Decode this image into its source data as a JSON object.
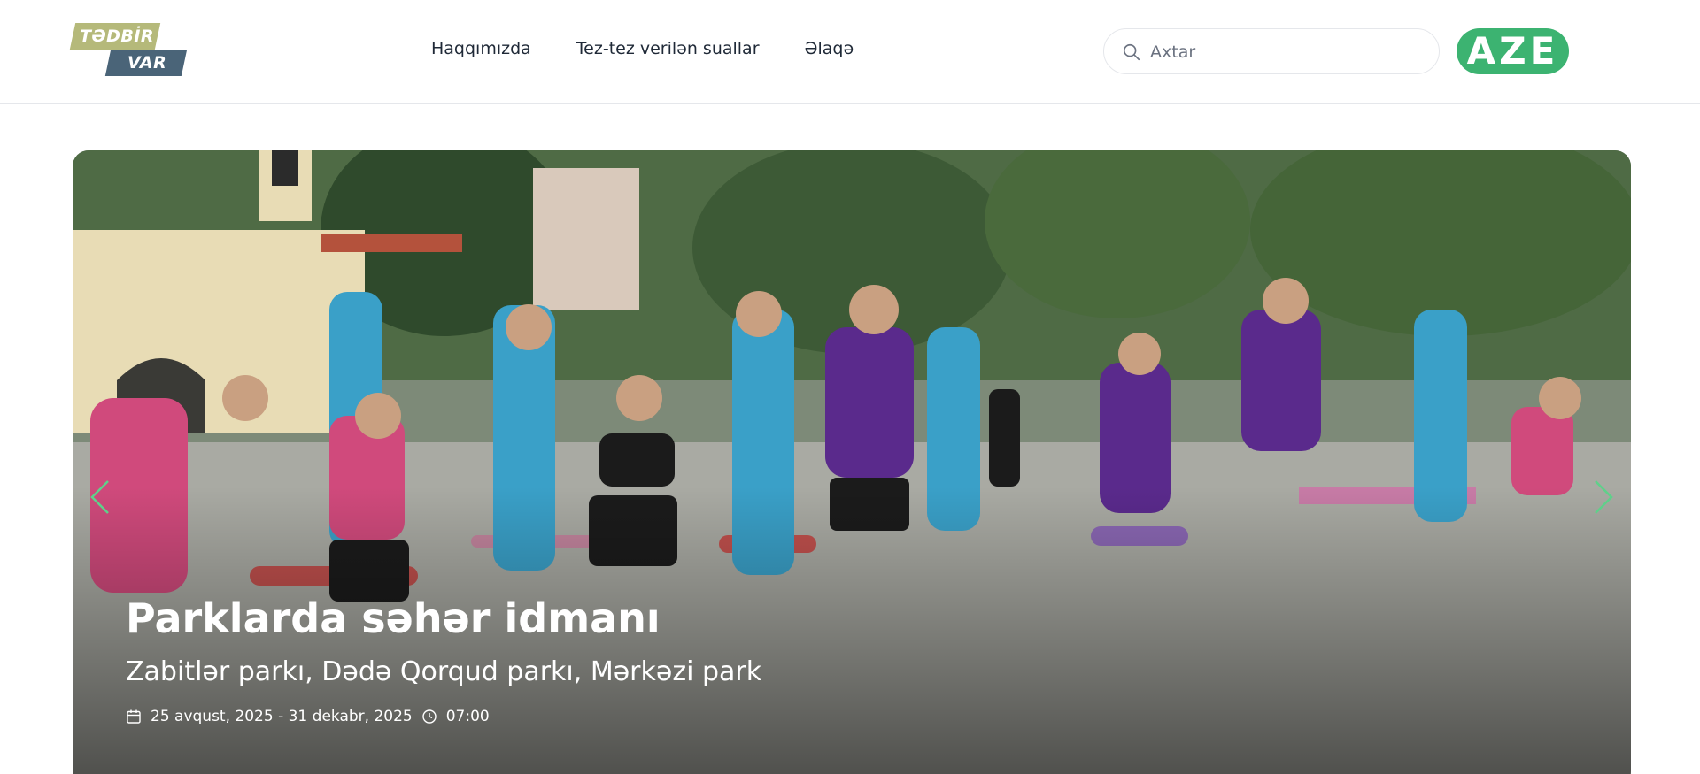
{
  "logo": {
    "top": "TƏDBİR",
    "bottom": "VAR"
  },
  "nav": [
    {
      "label": "Haqqımızda"
    },
    {
      "label": "Tez-tez verilən suallar"
    },
    {
      "label": "Əlaqə"
    }
  ],
  "search": {
    "placeholder": "Axtar"
  },
  "language": {
    "label": "AZE"
  },
  "colors": {
    "accent": "#3cb371",
    "logo_top": "#b5b97a",
    "logo_bottom": "#4a6478"
  },
  "hero": {
    "title": "Parklarda səhər idmanı",
    "subtitle": "Zabitlər parkı, Dədə Qorqud parkı, Mərkəzi park",
    "dates": "25 avqust, 2025 - 31 dekabr, 2025",
    "time": "07:00",
    "icons": {
      "prev": "chevron-left-icon",
      "next": "chevron-right-icon",
      "calendar": "calendar-icon",
      "clock": "clock-icon"
    }
  }
}
